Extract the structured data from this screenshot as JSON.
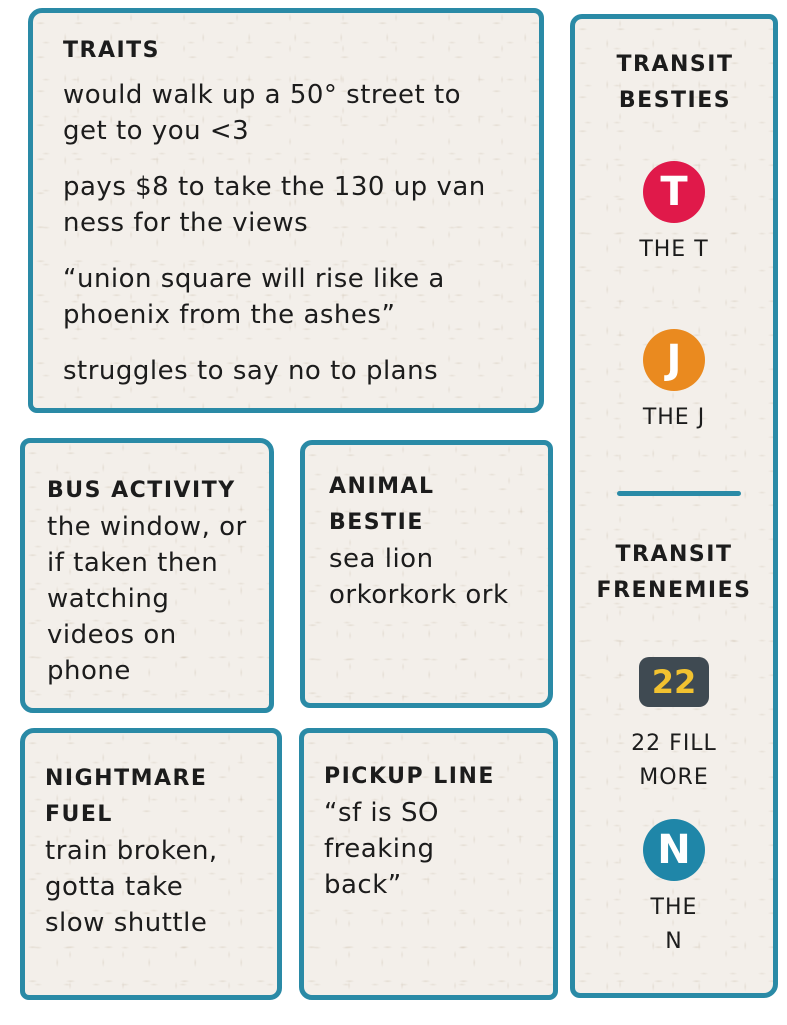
{
  "traits": {
    "heading": "TRAITS",
    "items": [
      "would walk up a 50° street to get to you <3",
      "pays $8 to take the 130 up van ness for the views",
      "“union square will rise like a phoenix from the ashes”",
      "struggles to say no to plans"
    ]
  },
  "bus_activity": {
    "heading": "BUS ACTIVITY",
    "text": "the window, or if taken then watching videos on phone"
  },
  "animal_bestie": {
    "heading": "ANIMAL BESTIE",
    "text": "sea lion orkorkork ork"
  },
  "nightmare_fuel": {
    "heading": "NIGHTMARE FUEL",
    "text": "train broken, gotta take slow shuttle"
  },
  "pickup_line": {
    "heading": "PICKUP LINE",
    "text": "“sf is SO freaking back”"
  },
  "sidebar": {
    "besties_heading": "TRANSIT BESTIES",
    "besties": [
      {
        "badge": "T",
        "label": "THE T",
        "color": "#e0194a"
      },
      {
        "badge": "J",
        "label": "THE J",
        "color": "#ea8a1f"
      }
    ],
    "frenemies_heading": "TRANSIT FRENEMIES",
    "frenemies": [
      {
        "badge": "22",
        "label": "22 FILL MORE",
        "color": "#3f4a52",
        "text_color": "#f2c230"
      },
      {
        "badge": "N",
        "label": "THE N",
        "color": "#1f86a8"
      }
    ]
  },
  "colors": {
    "border": "#2a8aa6",
    "card_bg": "#f3efea"
  }
}
